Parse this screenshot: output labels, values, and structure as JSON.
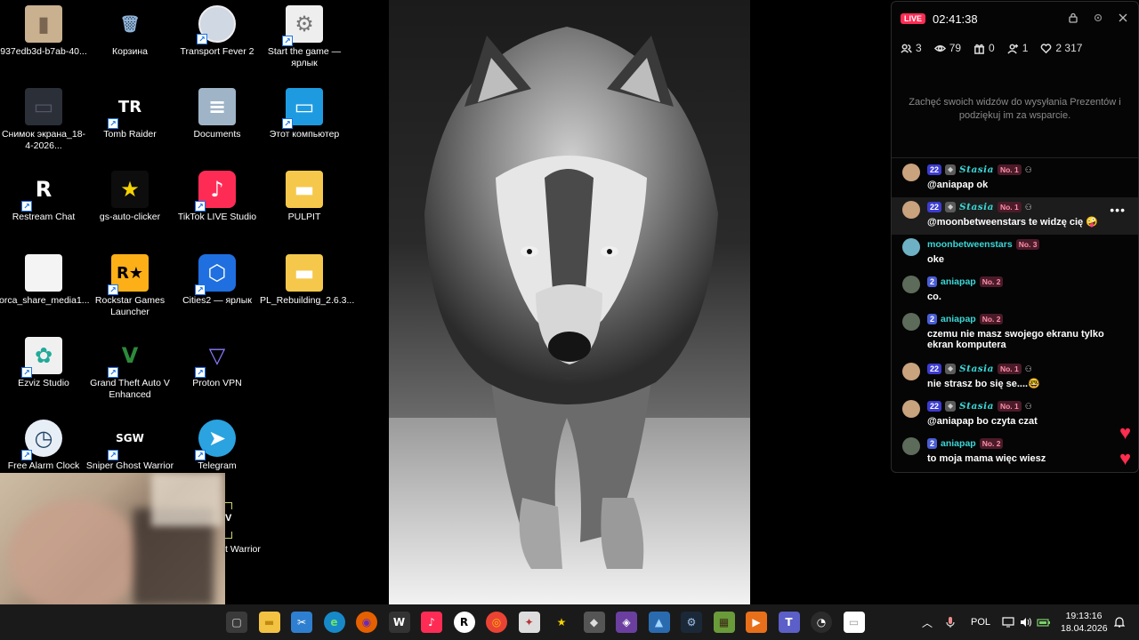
{
  "desktop": {
    "icons": [
      {
        "label": "937edb3d-b7ab-40...",
        "icon": "file-icon",
        "col": 0,
        "row": 0,
        "shortcut": false
      },
      {
        "label": "Корзина",
        "icon": "recycle-bin-icon",
        "col": 1,
        "row": 0,
        "shortcut": false
      },
      {
        "label": "Transport Fever 2",
        "icon": "transport-fever-icon",
        "col": 2,
        "row": 0,
        "shortcut": true
      },
      {
        "label": "Start the game — ярлык",
        "icon": "settings-window-icon",
        "col": 3,
        "row": 0,
        "shortcut": true
      },
      {
        "label": "Снимок экрана_18-4-2026...",
        "icon": "screenshot-icon",
        "col": 0,
        "row": 1,
        "shortcut": false
      },
      {
        "label": "Tomb Raider",
        "icon": "tomb-raider-icon",
        "col": 1,
        "row": 1,
        "shortcut": true
      },
      {
        "label": "Documents",
        "icon": "documents-folder-icon",
        "col": 2,
        "row": 1,
        "shortcut": false
      },
      {
        "label": "Этот компьютер",
        "icon": "this-pc-icon",
        "col": 3,
        "row": 1,
        "shortcut": true
      },
      {
        "label": "Restream Chat",
        "icon": "restream-icon",
        "col": 0,
        "row": 2,
        "shortcut": true
      },
      {
        "label": "gs-auto-clicker",
        "icon": "star-clicker-icon",
        "col": 1,
        "row": 2,
        "shortcut": false
      },
      {
        "label": "TikTok LIVE Studio",
        "icon": "tiktok-icon",
        "col": 2,
        "row": 2,
        "shortcut": true
      },
      {
        "label": "PULPIT",
        "icon": "folder-icon",
        "col": 3,
        "row": 2,
        "shortcut": false
      },
      {
        "label": "orca_share_media1...",
        "icon": "blank-file-icon",
        "col": 0,
        "row": 3,
        "shortcut": false
      },
      {
        "label": "Rockstar Games Launcher",
        "icon": "rockstar-icon",
        "col": 1,
        "row": 3,
        "shortcut": true
      },
      {
        "label": "Cities2 — ярлык",
        "icon": "cities2-icon",
        "col": 2,
        "row": 3,
        "shortcut": true
      },
      {
        "label": "PL_Rebuilding_2.6.3...",
        "icon": "folder-icon",
        "col": 3,
        "row": 3,
        "shortcut": false
      },
      {
        "label": "Ezviz Studio",
        "icon": "ezviz-icon",
        "col": 0,
        "row": 4,
        "shortcut": true
      },
      {
        "label": "Grand Theft Auto V Enhanced",
        "icon": "gta-v-icon",
        "col": 1,
        "row": 4,
        "shortcut": true
      },
      {
        "label": "Proton VPN",
        "icon": "proton-vpn-icon",
        "col": 2,
        "row": 4,
        "shortcut": true
      },
      {
        "label": "Free Alarm Clock",
        "icon": "alarm-clock-icon",
        "col": 0,
        "row": 5,
        "shortcut": true
      },
      {
        "label": "Sniper Ghost Warrior",
        "icon": "sgw-icon",
        "col": 1,
        "row": 5,
        "shortcut": true
      },
      {
        "label": "Telegram",
        "icon": "telegram-icon",
        "col": 2,
        "row": 5,
        "shortcut": true
      }
    ],
    "partial_label": "t Warrior"
  },
  "live": {
    "badge": "LIVE",
    "timer": "02:41:38",
    "stats": {
      "guests": "3",
      "viewers": "79",
      "gifts": "0",
      "follows": "1",
      "likes": "2 317"
    },
    "gift_note": "Zachęć swoich widzów do wysyłania Prezentów i podziękuj im za wsparcie."
  },
  "chat": [
    {
      "level": "22",
      "user": "Stasia",
      "rank": "No. 1",
      "mod": true,
      "text": "@aniapap ok",
      "avatar": "#c9a27e",
      "italic": true
    },
    {
      "level": "22",
      "user": "Stasia",
      "rank": "No. 1",
      "mod": true,
      "text": "@moonbetweenstars te widzę cię 🤪",
      "avatar": "#c9a27e",
      "italic": true,
      "active": true
    },
    {
      "level": "",
      "user": "moonbetweenstars",
      "rank": "No. 3",
      "mod": false,
      "text": "oke",
      "avatar": "#6fb1c4",
      "italic": false
    },
    {
      "level": "2",
      "user": "aniapap",
      "rank": "No. 2",
      "mod": false,
      "text": "co.",
      "avatar": "#5d6b5a",
      "italic": false
    },
    {
      "level": "2",
      "user": "aniapap",
      "rank": "No. 2",
      "mod": false,
      "text": "czemu nie masz swojego ekranu tylko ekran komputera",
      "avatar": "#5d6b5a",
      "italic": false
    },
    {
      "level": "22",
      "user": "Stasia",
      "rank": "No. 1",
      "mod": true,
      "text": "nie strasz bo się se....🤓",
      "avatar": "#c9a27e",
      "italic": true
    },
    {
      "level": "22",
      "user": "Stasia",
      "rank": "No. 1",
      "mod": true,
      "text": "@aniapap bo czyta czat",
      "avatar": "#c9a27e",
      "italic": true
    },
    {
      "level": "2",
      "user": "aniapap",
      "rank": "No. 2",
      "mod": false,
      "text": "to moja mama więc wiesz",
      "avatar": "#5d6b5a",
      "italic": false
    }
  ],
  "taskbar": {
    "apps": [
      {
        "name": "taskview-icon",
        "glyph": "▢",
        "bg": "#3a3a3a",
        "fg": "#ddd"
      },
      {
        "name": "file-explorer-icon",
        "glyph": "▬",
        "bg": "#f2c343",
        "fg": "#c08a10"
      },
      {
        "name": "snipping-tool-icon",
        "glyph": "✂",
        "bg": "#2f7fd1",
        "fg": "#fff"
      },
      {
        "name": "edge-icon",
        "glyph": "e",
        "bg": "#1789c9",
        "fg": "#6ee36e"
      },
      {
        "name": "firefox-icon",
        "glyph": "◉",
        "bg": "#e66000",
        "fg": "#6a2ab8"
      },
      {
        "name": "wo-icon",
        "glyph": "W",
        "bg": "#333",
        "fg": "#fff"
      },
      {
        "name": "tiktok-taskbar-icon",
        "glyph": "♪",
        "bg": "#fe2c55",
        "fg": "#fff"
      },
      {
        "name": "restream-taskbar-icon",
        "glyph": "R",
        "bg": "#fff",
        "fg": "#000"
      },
      {
        "name": "chrome-icon",
        "glyph": "◎",
        "bg": "#ea4335",
        "fg": "#fbbc05"
      },
      {
        "name": "compass-icon",
        "glyph": "✦",
        "bg": "#ddd",
        "fg": "#b33"
      },
      {
        "name": "clicker-taskbar-icon",
        "glyph": "★",
        "bg": "#1a1a1a",
        "fg": "#f5d300"
      },
      {
        "name": "package-icon",
        "glyph": "◆",
        "bg": "#555",
        "fg": "#ddd"
      },
      {
        "name": "games-icon",
        "glyph": "◈",
        "bg": "#6b3fa0",
        "fg": "#fff"
      },
      {
        "name": "photos-icon",
        "glyph": "▲",
        "bg": "#2a6bb0",
        "fg": "#9fd6ff"
      },
      {
        "name": "steam-icon",
        "glyph": "⚙",
        "bg": "#1b2838",
        "fg": "#9ec1e6"
      },
      {
        "name": "minecraft-icon",
        "glyph": "▦",
        "bg": "#6a9b3a",
        "fg": "#3b2a14"
      },
      {
        "name": "media-player-icon",
        "glyph": "▶",
        "bg": "#e8701a",
        "fg": "#fff"
      },
      {
        "name": "teams-icon",
        "glyph": "T",
        "bg": "#5b5fc7",
        "fg": "#fff"
      },
      {
        "name": "clock-app-icon",
        "glyph": "◔",
        "bg": "#2b2b2b",
        "fg": "#fff"
      },
      {
        "name": "notepad-icon",
        "glyph": "▭",
        "bg": "#fff",
        "fg": "#999"
      }
    ],
    "lang": "POL",
    "time": "19:13:16",
    "date": "18.04.2026"
  }
}
